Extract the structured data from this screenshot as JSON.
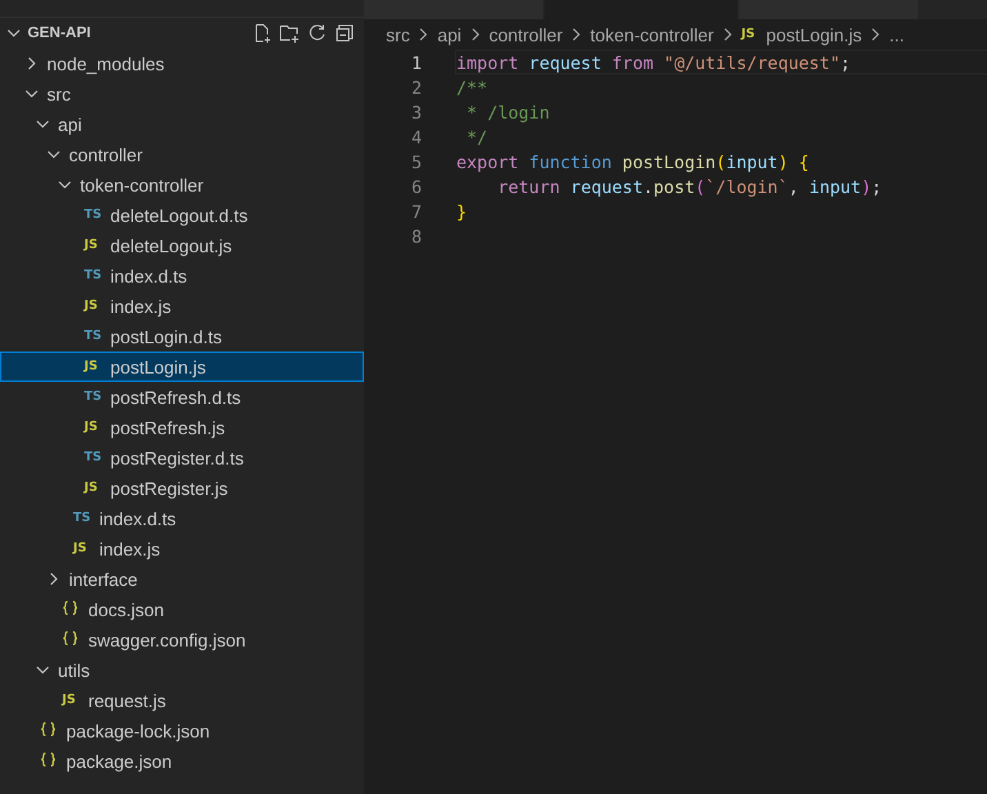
{
  "tabs": [
    {
      "selected": false
    },
    {
      "selected": true
    },
    {
      "selected": false
    }
  ],
  "explorer": {
    "title": "GEN-API",
    "expanded": true,
    "tree": [
      {
        "name": "node_modules",
        "kind": "folder",
        "expanded": false,
        "selected": false
      },
      {
        "name": "src",
        "kind": "folder",
        "expanded": true,
        "selected": false,
        "children": [
          {
            "name": "api",
            "kind": "folder",
            "expanded": true,
            "selected": false,
            "children": [
              {
                "name": "controller",
                "kind": "folder",
                "expanded": true,
                "selected": false,
                "children": [
                  {
                    "name": "token-controller",
                    "kind": "folder",
                    "expanded": true,
                    "selected": false,
                    "children": [
                      {
                        "name": "deleteLogout.d.ts",
                        "kind": "ts",
                        "icon": "TS",
                        "selected": false
                      },
                      {
                        "name": "deleteLogout.js",
                        "kind": "js",
                        "icon": "JS",
                        "selected": false
                      },
                      {
                        "name": "index.d.ts",
                        "kind": "ts",
                        "icon": "TS",
                        "selected": false
                      },
                      {
                        "name": "index.js",
                        "kind": "js",
                        "icon": "JS",
                        "selected": false
                      },
                      {
                        "name": "postLogin.d.ts",
                        "kind": "ts",
                        "icon": "TS",
                        "selected": false
                      },
                      {
                        "name": "postLogin.js",
                        "kind": "js",
                        "icon": "JS",
                        "selected": true
                      },
                      {
                        "name": "postRefresh.d.ts",
                        "kind": "ts",
                        "icon": "TS",
                        "selected": false
                      },
                      {
                        "name": "postRefresh.js",
                        "kind": "js",
                        "icon": "JS",
                        "selected": false
                      },
                      {
                        "name": "postRegister.d.ts",
                        "kind": "ts",
                        "icon": "TS",
                        "selected": false
                      },
                      {
                        "name": "postRegister.js",
                        "kind": "js",
                        "icon": "JS",
                        "selected": false
                      }
                    ]
                  },
                  {
                    "name": "index.d.ts",
                    "kind": "ts",
                    "icon": "TS",
                    "selected": false
                  },
                  {
                    "name": "index.js",
                    "kind": "js",
                    "icon": "JS",
                    "selected": false
                  }
                ]
              },
              {
                "name": "interface",
                "kind": "folder",
                "expanded": false,
                "selected": false
              },
              {
                "name": "docs.json",
                "kind": "json",
                "selected": false
              },
              {
                "name": "swagger.config.json",
                "kind": "json",
                "selected": false
              }
            ]
          },
          {
            "name": "utils",
            "kind": "folder",
            "expanded": true,
            "selected": false,
            "children": [
              {
                "name": "request.js",
                "kind": "js",
                "icon": "JS",
                "selected": false
              }
            ]
          }
        ]
      },
      {
        "name": "package-lock.json",
        "kind": "json",
        "selected": false
      },
      {
        "name": "package.json",
        "kind": "json",
        "selected": false
      }
    ]
  },
  "breadcrumb": [
    {
      "text": "src",
      "kind": "folder"
    },
    {
      "text": "api",
      "kind": "folder"
    },
    {
      "text": "controller",
      "kind": "folder"
    },
    {
      "text": "token-controller",
      "kind": "folder"
    },
    {
      "text": "postLogin.js",
      "kind": "js",
      "icon": "JS"
    },
    {
      "text": "...",
      "kind": "more"
    }
  ],
  "editor": {
    "lines": [
      {
        "number": "1",
        "active": true,
        "tokens": [
          {
            "text": "import",
            "kind": "keyword"
          },
          {
            "text": " request",
            "kind": "variable"
          },
          {
            "text": " from",
            "kind": "keyword"
          },
          {
            "text": " \"@/utils/request\"",
            "kind": "string"
          },
          {
            "text": ";",
            "kind": "plain"
          }
        ]
      },
      {
        "number": "2",
        "active": false,
        "tokens": [
          {
            "text": "/**",
            "kind": "comment"
          }
        ]
      },
      {
        "number": "3",
        "active": false,
        "tokens": [
          {
            "text": " * /login",
            "kind": "comment"
          }
        ]
      },
      {
        "number": "4",
        "active": false,
        "tokens": [
          {
            "text": " */",
            "kind": "comment"
          }
        ]
      },
      {
        "number": "5",
        "active": false,
        "tokens": [
          {
            "text": "export",
            "kind": "keyword"
          },
          {
            "text": " function",
            "kind": "storage"
          },
          {
            "text": " postLogin",
            "kind": "function"
          },
          {
            "text": "(",
            "kind": "bracket"
          },
          {
            "text": "input",
            "kind": "variable"
          },
          {
            "text": ")",
            "kind": "bracket"
          },
          {
            "text": " {",
            "kind": "bracket"
          }
        ]
      },
      {
        "number": "6",
        "active": false,
        "tokens": [
          {
            "text": "    return",
            "kind": "keyword"
          },
          {
            "text": " request",
            "kind": "variable"
          },
          {
            "text": ".",
            "kind": "plain"
          },
          {
            "text": "post",
            "kind": "function"
          },
          {
            "text": "(",
            "kind": "bracket2"
          },
          {
            "text": "`/login`",
            "kind": "string"
          },
          {
            "text": ", ",
            "kind": "plain"
          },
          {
            "text": "input",
            "kind": "variable"
          },
          {
            "text": ")",
            "kind": "bracket2"
          },
          {
            "text": ";",
            "kind": "plain"
          }
        ]
      },
      {
        "number": "7",
        "active": false,
        "tokens": [
          {
            "text": "}",
            "kind": "bracket"
          }
        ]
      },
      {
        "number": "8",
        "active": false
      }
    ]
  }
}
